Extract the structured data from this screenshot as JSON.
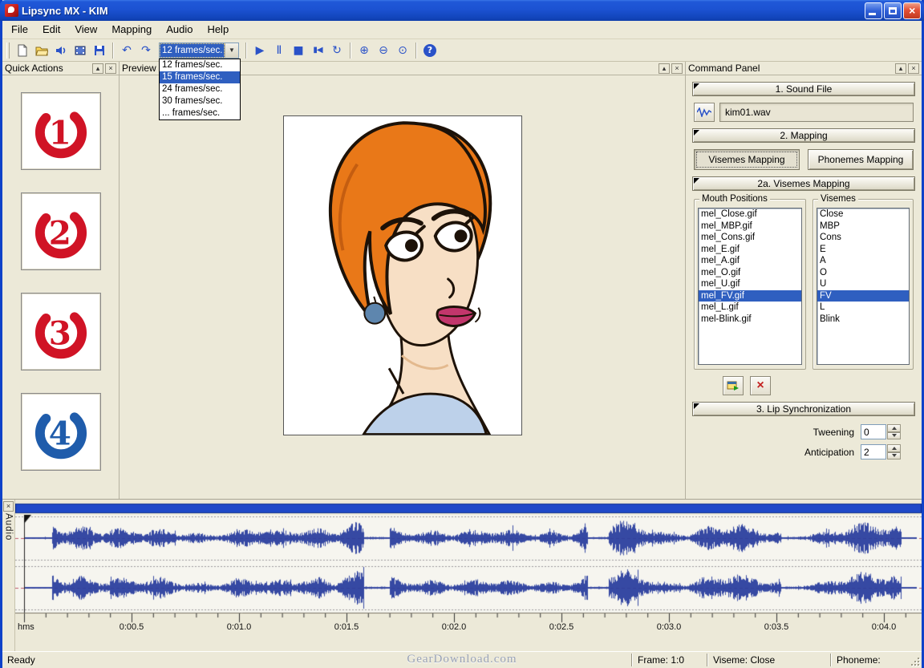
{
  "window": {
    "title": "Lipsync MX - KIM"
  },
  "menu": [
    "File",
    "Edit",
    "View",
    "Mapping",
    "Audio",
    "Help"
  ],
  "toolbar": {
    "fps_value": "12 frames/sec.",
    "fps_options": [
      "12 frames/sec.",
      "15 frames/sec.",
      "24 frames/sec.",
      "30 frames/sec.",
      "... frames/sec."
    ],
    "fps_highlighted": "15 frames/sec.",
    "icons": {
      "undo": "↶",
      "redo": "↷",
      "play": "▶",
      "pause": "Ⅱ",
      "stop": "■",
      "go_start": "▮◀",
      "loop": "↻",
      "zoom_in": "⊕",
      "zoom_out": "⊖",
      "zoom_fit": "⊙",
      "help": "?",
      "dropdown_arrow": "▼"
    }
  },
  "quick_actions": {
    "title": "Quick Actions",
    "buttons": [
      {
        "label": "1",
        "color": "#d01325"
      },
      {
        "label": "2",
        "color": "#d01325"
      },
      {
        "label": "3",
        "color": "#d01325"
      },
      {
        "label": "4",
        "color": "#1f5cab"
      }
    ]
  },
  "preview": {
    "title": "Preview"
  },
  "command_panel": {
    "title": "Command Panel",
    "sound_file": {
      "header": "1. Sound File",
      "filename": "kim01.wav"
    },
    "mapping": {
      "header": "2. Mapping",
      "visemes_tab": "Visemes Mapping",
      "phonemes_tab": "Phonemes Mapping"
    },
    "visemes_mapping": {
      "header": "2a. Visemes Mapping",
      "mouth_positions_label": "Mouth Positions",
      "mouth_positions": [
        "mel_Close.gif",
        "mel_MBP.gif",
        "mel_Cons.gif",
        "mel_E.gif",
        "mel_A.gif",
        "mel_O.gif",
        "mel_U.gif",
        "mel_FV.gif",
        "mel_L.gif",
        "mel-Blink.gif"
      ],
      "mouth_selected": "mel_FV.gif",
      "visemes_label": "Visemes",
      "visemes": [
        "Close",
        "MBP",
        "Cons",
        "E",
        "A",
        "O",
        "U",
        "FV",
        "L",
        "Blink"
      ],
      "viseme_selected": "FV"
    },
    "lip_sync": {
      "header": "3. Lip Synchronization",
      "tweening_label": "Tweening",
      "tweening_value": "0",
      "anticipation_label": "Anticipation",
      "anticipation_value": "2"
    }
  },
  "audio_panel": {
    "title": "Audio",
    "ruler_unit": "hms",
    "time_labels": [
      "0:00.5",
      "0:01.0",
      "0:01.5",
      "0:02.0",
      "0:02.5",
      "0:03.0",
      "0:03.5",
      "0:04.0"
    ],
    "duration_seconds": 4.15
  },
  "status_bar": {
    "ready": "Ready",
    "watermark": "GearDownload.com",
    "frame": "Frame: 1:0",
    "viseme": "Viseme: Close",
    "phoneme": "Phoneme:"
  },
  "colors": {
    "selection": "#2f5fc0",
    "waveform": "#2b3f9e",
    "position_bar": "#1f49c8",
    "guide_center": "#c05a6a",
    "guide_edge": "#9a9a9a"
  }
}
